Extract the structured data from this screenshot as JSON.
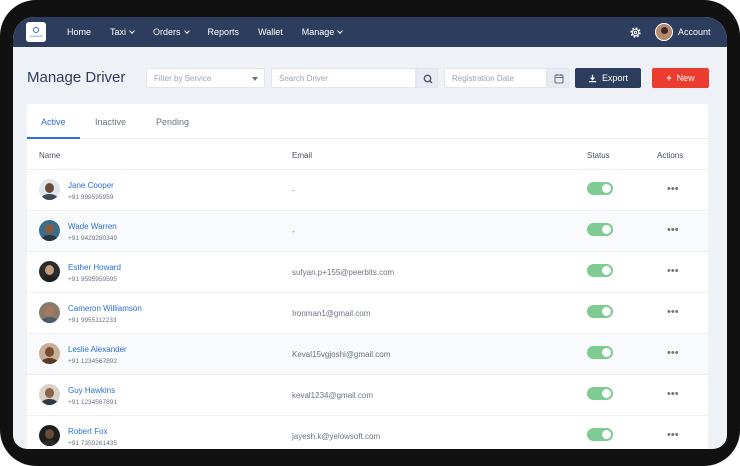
{
  "nav": {
    "logo_text": "yelowsoft",
    "items": [
      {
        "label": "Home",
        "dropdown": false
      },
      {
        "label": "Taxi",
        "dropdown": true
      },
      {
        "label": "Orders",
        "dropdown": true
      },
      {
        "label": "Reports",
        "dropdown": false
      },
      {
        "label": "Wallet",
        "dropdown": false
      },
      {
        "label": "Manage",
        "dropdown": true
      }
    ],
    "settings_icon": "gear-icon",
    "account_label": "Account"
  },
  "page": {
    "title": "Manage Driver",
    "filter_placeholder": "Filter by Service",
    "search_placeholder": "Search Driver",
    "date_placeholder": "Registration Date",
    "export_label": "Export",
    "new_label": "New"
  },
  "tabs": [
    {
      "label": "Active",
      "active": true
    },
    {
      "label": "Inactive",
      "active": false
    },
    {
      "label": "Pending",
      "active": false
    }
  ],
  "columns": {
    "name": "Name",
    "email": "Email",
    "status": "Status",
    "actions": "Actions"
  },
  "drivers": [
    {
      "name": "Jane Cooper",
      "phone": "+91 999595959",
      "email": "-",
      "active": true
    },
    {
      "name": "Wade Warren",
      "phone": "+91 9429280349",
      "email": "-",
      "active": true
    },
    {
      "name": "Esther Howard",
      "phone": "+91 9595959595",
      "email": "sufyan.p+155@peerbits.com",
      "active": true
    },
    {
      "name": "Cameron Williamson",
      "phone": "+91 9955112233",
      "email": "Ironman1@gmail.com",
      "active": true
    },
    {
      "name": "Leslie Alexander",
      "phone": "+91 1234567892",
      "email": "Keval15vgjoshi@gmail.com",
      "active": true
    },
    {
      "name": "Guy Hawkins",
      "phone": "+91 1234567891",
      "email": "keval1234@gmail.com",
      "active": true
    },
    {
      "name": "Robert Fox",
      "phone": "+91 7359261435",
      "email": "jayesh.k@yelowsoft.com",
      "active": true
    }
  ],
  "actions_glyph": "•••",
  "colors": {
    "navbar": "#2d3d5e",
    "accent": "#2b6fd6",
    "new_button": "#ec3b2f",
    "toggle_on": "#7ecb94"
  }
}
